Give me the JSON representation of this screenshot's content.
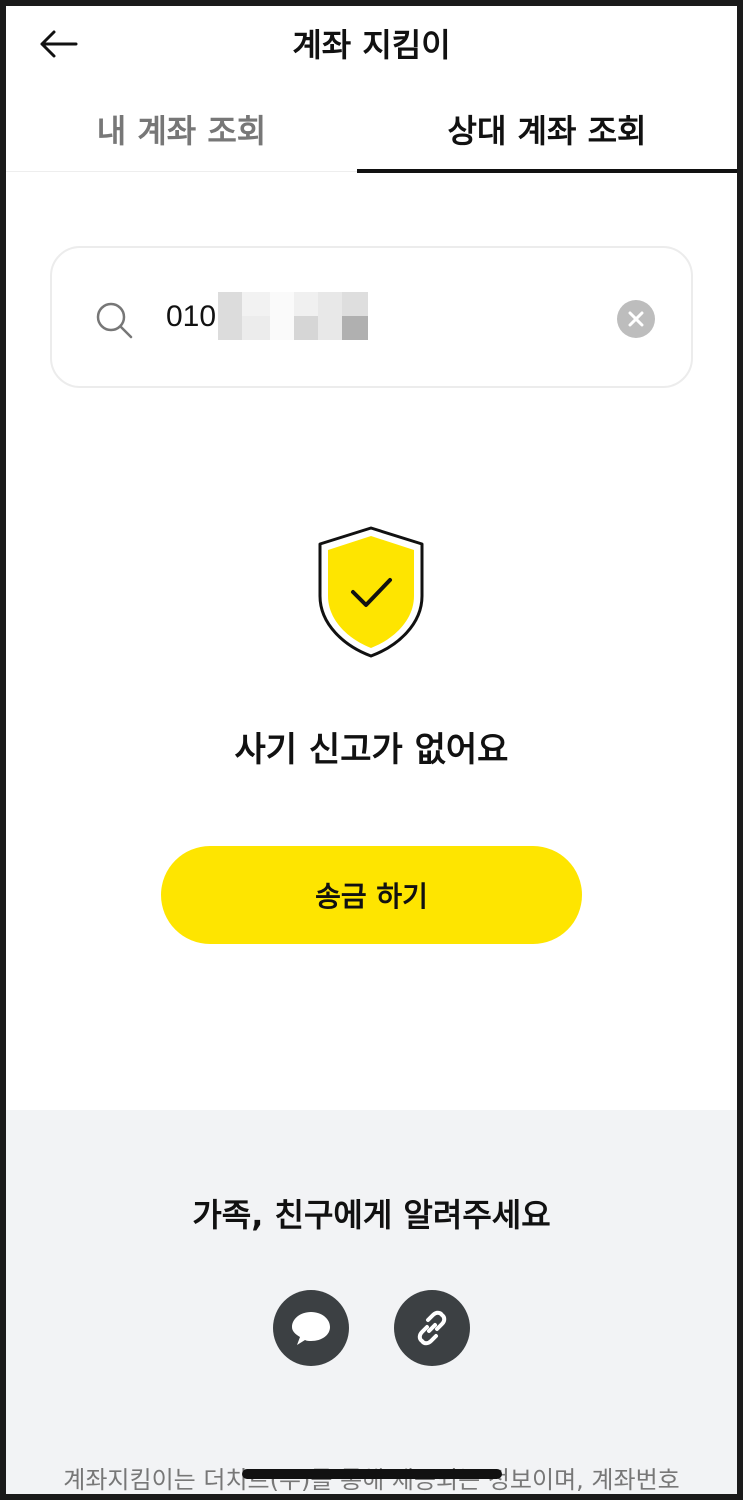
{
  "header": {
    "title": "계좌 지킴이",
    "back_icon": "arrow-left-icon"
  },
  "tabs": [
    {
      "label": "내 계좌 조회",
      "active": false
    },
    {
      "label": "상대 계좌 조회",
      "active": true
    }
  ],
  "search": {
    "value": "010",
    "icons": {
      "search": "search-icon",
      "clear": "clear-icon"
    }
  },
  "result": {
    "icon": "shield-check-icon",
    "message": "사기 신고가 없어요",
    "send_button": "송금 하기"
  },
  "share": {
    "title": "가족, 친구에게 알려주세요",
    "buttons": [
      {
        "icon": "chat-bubble-icon"
      },
      {
        "icon": "link-icon"
      }
    ],
    "disclaimer": "계좌지킴이는 더치트(주)를 통해 제공되는 정보이며, 계좌번호"
  },
  "colors": {
    "accent": "#FEE500",
    "text": "#111111",
    "muted": "#777777",
    "section_bg": "#F2F3F5",
    "icon_button": "#3C4043"
  }
}
